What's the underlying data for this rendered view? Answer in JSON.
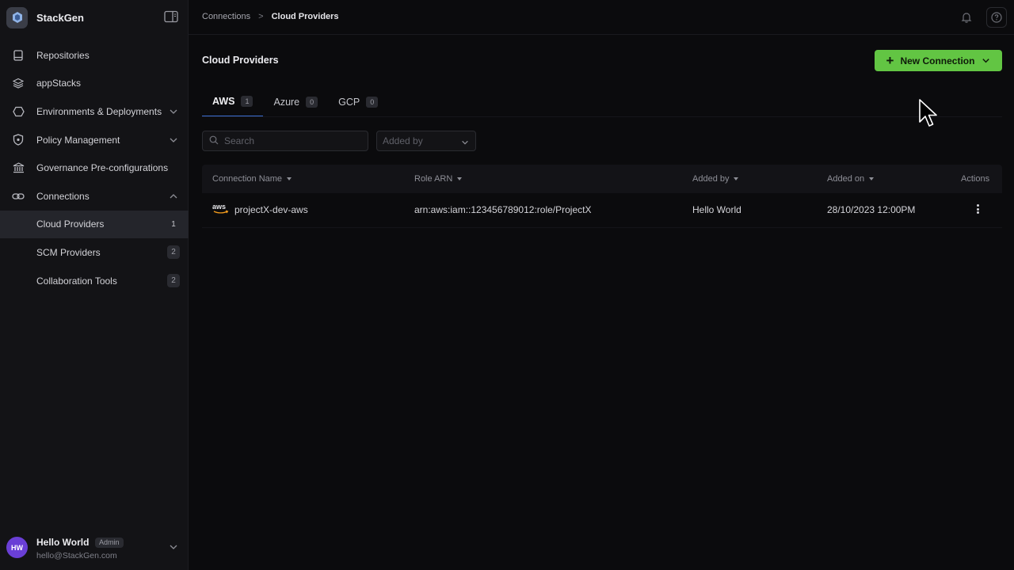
{
  "app": {
    "name": "StackGen"
  },
  "sidebar": {
    "items": [
      {
        "label": "Repositories",
        "icon": "repository-icon"
      },
      {
        "label": "appStacks",
        "icon": "layers-icon"
      },
      {
        "label": "Environments & Deployments",
        "icon": "hexagon-icon"
      },
      {
        "label": "Policy Management",
        "icon": "shield-icon"
      },
      {
        "label": "Governance Pre-configurations",
        "icon": "bank-icon"
      },
      {
        "label": "Connections",
        "icon": "link-icon"
      }
    ],
    "connections_sub": [
      {
        "label": "Cloud Providers",
        "count": "1"
      },
      {
        "label": "SCM Providers",
        "count": "2"
      },
      {
        "label": "Collaboration Tools",
        "count": "2"
      }
    ]
  },
  "user": {
    "initials": "HW",
    "name": "Hello World",
    "role": "Admin",
    "email": "hello@StackGen.com"
  },
  "breadcrumb": {
    "parent": "Connections",
    "separator": ">",
    "current": "Cloud Providers"
  },
  "page": {
    "title": "Cloud Providers",
    "new_button": "New Connection"
  },
  "tabs": [
    {
      "label": "AWS",
      "count": "1"
    },
    {
      "label": "Azure",
      "count": "0"
    },
    {
      "label": "GCP",
      "count": "0"
    }
  ],
  "search": {
    "placeholder": "Search"
  },
  "filter": {
    "placeholder": "Added by"
  },
  "table": {
    "columns": [
      "Connection Name",
      "Role ARN",
      "Added by",
      "Added on",
      "Actions"
    ],
    "rows": [
      {
        "logo": "aws",
        "name": "projectX-dev-aws",
        "arn": "arn:aws:iam::123456789012:role/ProjectX",
        "added_by": "Hello World",
        "added_on": "28/10/2023 12:00PM"
      }
    ]
  },
  "colors": {
    "accent": "#62c543",
    "tab_underline": "#3c6fd4",
    "avatar": "#6a3fd6"
  }
}
